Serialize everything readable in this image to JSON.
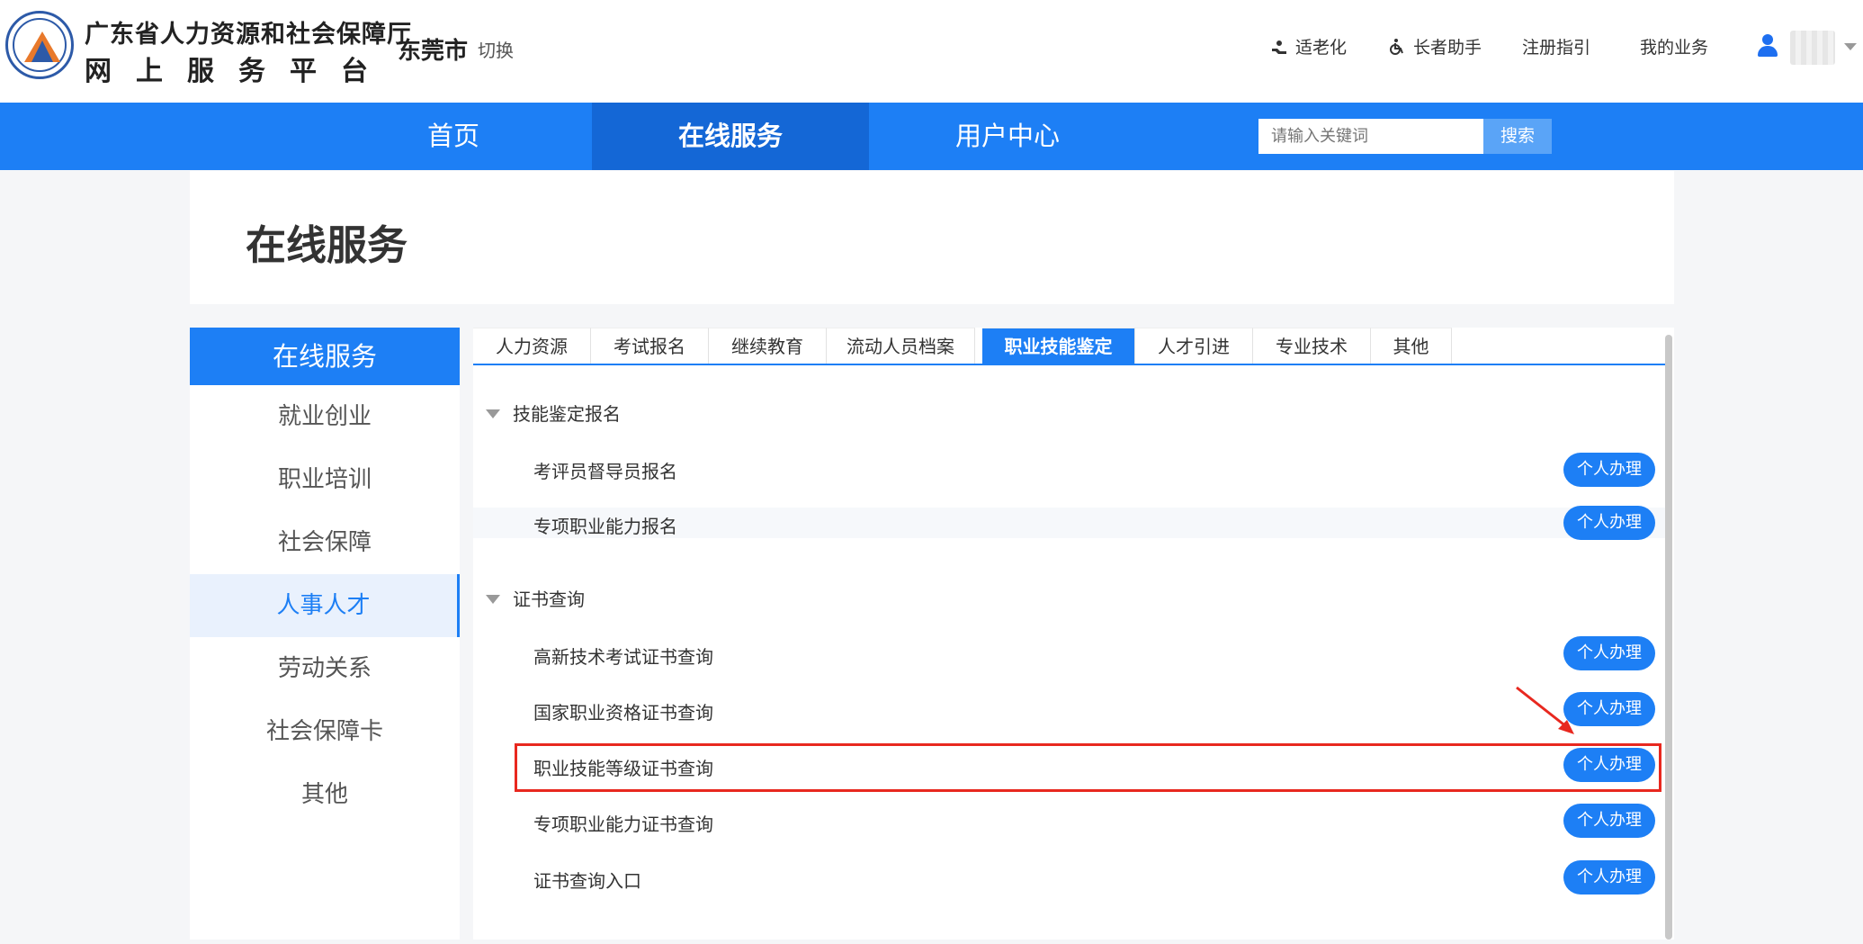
{
  "header": {
    "title_line1": "广东省人力资源和社会保障厅",
    "title_line2": "网上服务平台",
    "city": "东莞市",
    "switch_label": "切换",
    "links": [
      {
        "label": "适老化",
        "icon": "elderly-hand-icon"
      },
      {
        "label": "长者助手",
        "icon": "wheelchair-icon"
      },
      {
        "label": "注册指引",
        "icon": ""
      },
      {
        "label": "我的业务",
        "icon": ""
      }
    ],
    "user_icon": "user-icon"
  },
  "nav": {
    "items": [
      "首页",
      "在线服务",
      "用户中心"
    ],
    "active": "在线服务",
    "search_placeholder": "请输入关键词",
    "search_button": "搜索"
  },
  "page": {
    "title": "在线服务"
  },
  "side_menu": {
    "header": "在线服务",
    "items": [
      "就业创业",
      "职业培训",
      "社会保障",
      "人事人才",
      "劳动关系",
      "社会保障卡",
      "其他"
    ],
    "active": "人事人才"
  },
  "tabs": {
    "items": [
      "人力资源",
      "考试报名",
      "继续教育",
      "流动人员档案",
      "职业技能鉴定",
      "人才引进",
      "专业技术",
      "其他"
    ],
    "active": "职业技能鉴定"
  },
  "sections": [
    {
      "title": "技能鉴定报名",
      "rows": [
        {
          "label": "考评员督导员报名",
          "button": "个人办理"
        },
        {
          "label": "专项职业能力报名",
          "button": "个人办理"
        }
      ]
    },
    {
      "title": "证书查询",
      "rows": [
        {
          "label": "高新技术考试证书查询",
          "button": "个人办理"
        },
        {
          "label": "国家职业资格证书查询",
          "button": "个人办理"
        },
        {
          "label": "职业技能等级证书查询",
          "button": "个人办理"
        },
        {
          "label": "专项职业能力证书查询",
          "button": "个人办理"
        },
        {
          "label": "证书查询入口",
          "button": "个人办理"
        }
      ]
    }
  ],
  "colors": {
    "primary": "#1d7ff5",
    "nav_active": "#1467d6",
    "highlight": "#e8281f"
  }
}
